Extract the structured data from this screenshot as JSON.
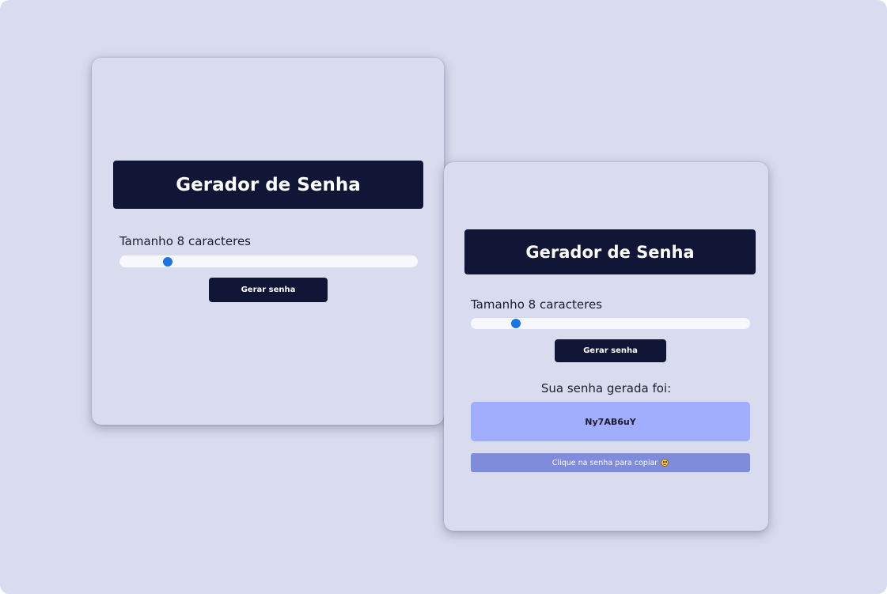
{
  "colors": {
    "background": "#d9dcef",
    "title_bg": "#111536",
    "button_bg": "#111536",
    "slider_thumb": "#1a74e8",
    "password_bg": "#a1adfd",
    "copy_hint_bg": "#7f8cdb"
  },
  "card_initial": {
    "title": "Gerador de Senha",
    "length_label": "Tamanho 8 caracteres",
    "slider_value": 8,
    "generate_button": "Gerar senha"
  },
  "card_result": {
    "title": "Gerador de Senha",
    "length_label": "Tamanho 8 caracteres",
    "slider_value": 8,
    "generate_button": "Gerar senha",
    "result_label": "Sua senha gerada foi:",
    "password": "Ny7AB6uY",
    "copy_hint": "Clique na senha para copiar",
    "copy_hint_icon": "smile-emoji-icon"
  }
}
